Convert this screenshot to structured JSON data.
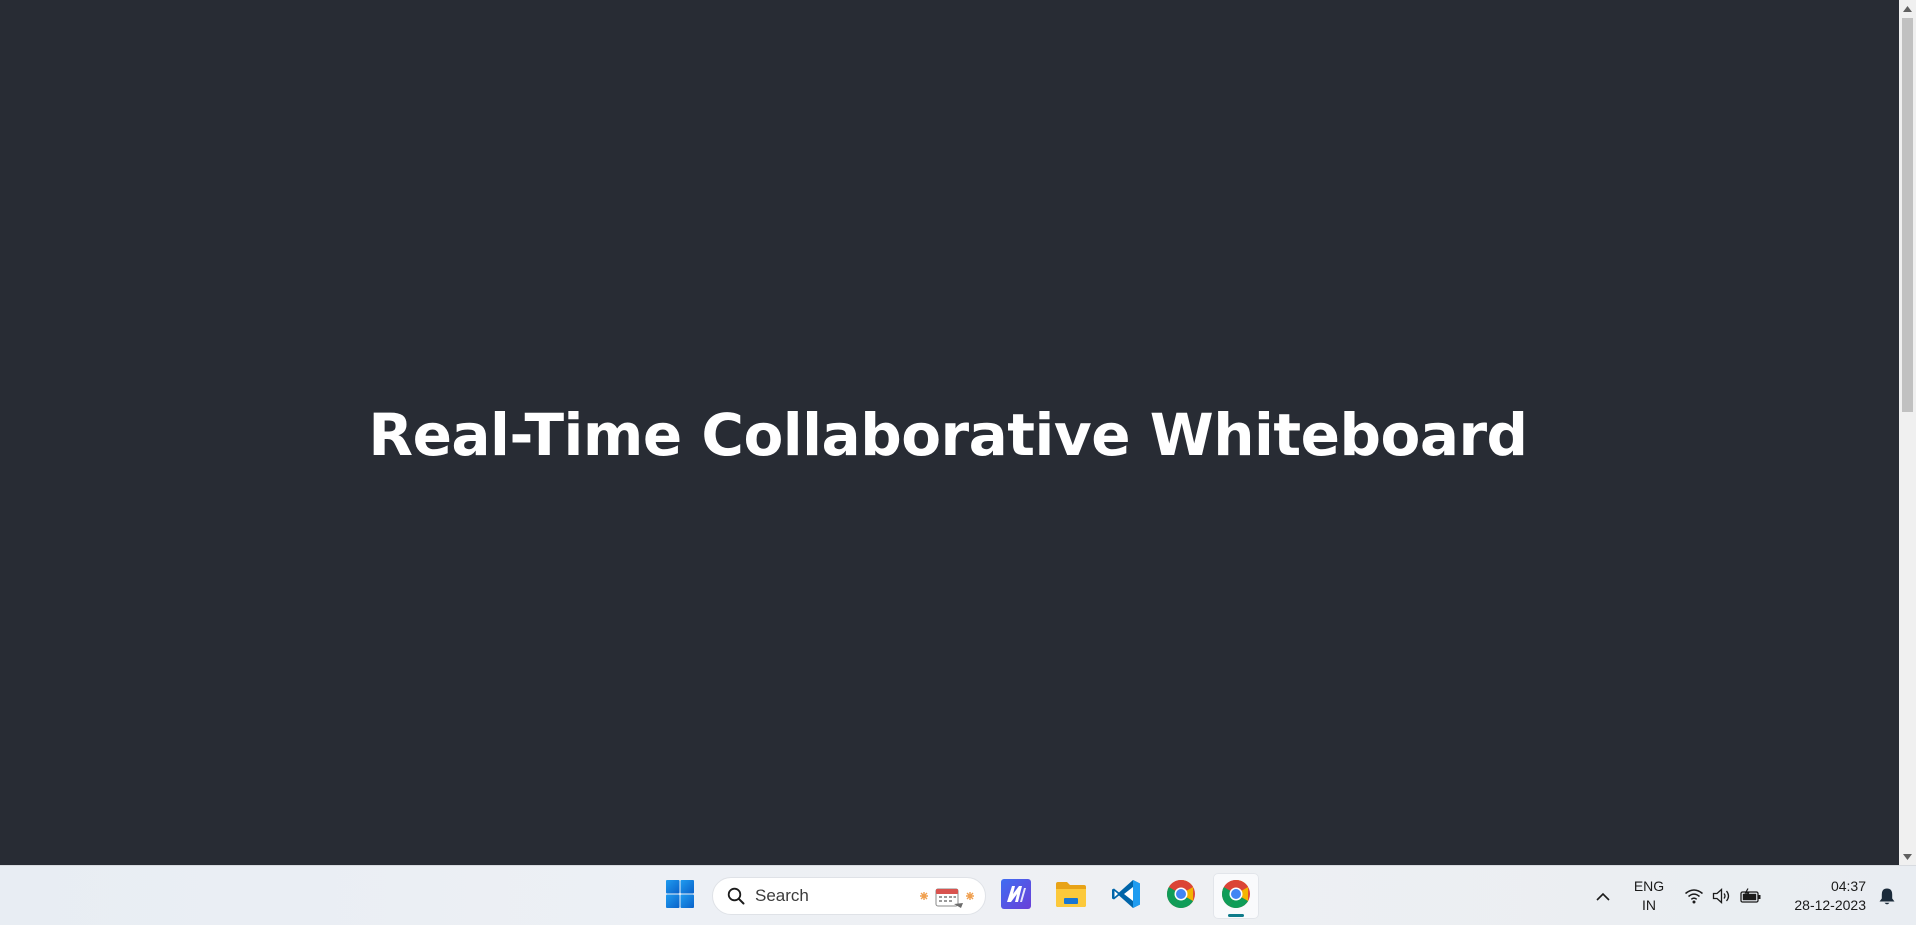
{
  "page": {
    "title": "Real-Time Collaborative Whiteboard",
    "background_color": "#282c34",
    "title_color": "#ffffff"
  },
  "scrollbar": {
    "up_icon": "scroll-up-arrow-icon",
    "down_icon": "scroll-down-arrow-icon"
  },
  "taskbar": {
    "start_icon": "windows-start-icon",
    "search": {
      "placeholder": "Search",
      "icon": "search-icon",
      "highlight_icon": "new-year-calendar-icon"
    },
    "pinned_apps": [
      {
        "name": "app-icon-m",
        "icon": "m-app-icon"
      },
      {
        "name": "file-explorer",
        "icon": "folder-icon"
      },
      {
        "name": "visual-studio-code",
        "icon": "vscode-icon"
      },
      {
        "name": "google-chrome",
        "icon": "chrome-icon"
      },
      {
        "name": "google-chrome-active",
        "icon": "chrome-icon",
        "active": true
      }
    ],
    "tray": {
      "overflow_icon": "chevron-up-icon",
      "language_line1": "ENG",
      "language_line2": "IN",
      "wifi_icon": "wifi-icon",
      "volume_icon": "volume-icon",
      "battery_icon": "battery-charging-icon",
      "time": "04:37",
      "date": "28-12-2023",
      "notification_icon": "notification-bell-icon"
    },
    "accent_color": "#0f7b8a"
  }
}
